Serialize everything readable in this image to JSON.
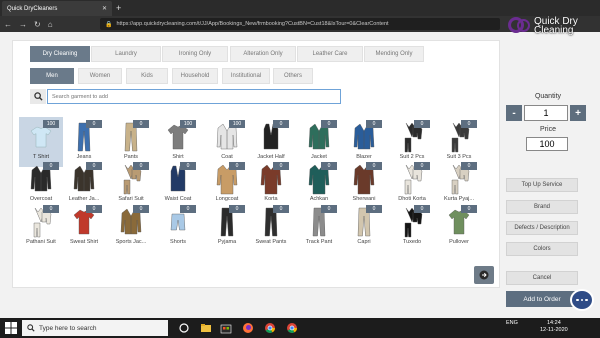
{
  "browser": {
    "tab_title": "Quick DryCleaners",
    "url": "https://app.quickdrycleaning.com/t/JJ/App/Bookings_New/frmbooking?CustBN=Cust18&IsTour=0&ClearContent"
  },
  "brand": {
    "line1": "Quick Dry",
    "line2": "Cleaning"
  },
  "service_tabs": [
    {
      "label": "Dry Cleaning",
      "active": true
    },
    {
      "label": "Laundry",
      "active": false
    },
    {
      "label": "Ironing Only",
      "active": false
    },
    {
      "label": "Alteration Only",
      "active": false
    },
    {
      "label": "Leather Care",
      "active": false
    },
    {
      "label": "Mending Only",
      "active": false
    }
  ],
  "category_tabs": [
    {
      "label": "Men",
      "active": true
    },
    {
      "label": "Women",
      "active": false
    },
    {
      "label": "Kids",
      "active": false
    },
    {
      "label": "Household",
      "active": false
    },
    {
      "label": "Institutional",
      "active": false
    },
    {
      "label": "Others",
      "active": false
    }
  ],
  "search": {
    "placeholder": "Search garment to add"
  },
  "garments": [
    {
      "label": "T Shirt",
      "count": "100",
      "selected": true,
      "icon": "tshirt",
      "color": "#cfe7f5"
    },
    {
      "label": "Jeans",
      "count": "0",
      "icon": "pants",
      "color": "#3c6fae"
    },
    {
      "label": "Pants",
      "count": "0",
      "icon": "pants",
      "color": "#c8b28a"
    },
    {
      "label": "Shirt",
      "count": "100",
      "icon": "shirt",
      "color": "#7d7d7d"
    },
    {
      "label": "Coat",
      "count": "100",
      "icon": "coat",
      "color": "#e5e5e5"
    },
    {
      "label": "Jacket Half",
      "count": "0",
      "icon": "vest",
      "color": "#222222"
    },
    {
      "label": "Jacket",
      "count": "0",
      "icon": "coat",
      "color": "#2e6e5c"
    },
    {
      "label": "Blazer",
      "count": "0",
      "icon": "coat",
      "color": "#2a5d9a"
    },
    {
      "label": "Suit 2 Pcs",
      "count": "0",
      "icon": "suit",
      "color": "#2b2b2b"
    },
    {
      "label": "Suit 3 Pcs",
      "count": "0",
      "icon": "suit",
      "color": "#3a3a3a"
    },
    {
      "label": "Overcoat",
      "count": "0",
      "icon": "coat",
      "color": "#2a2a2a"
    },
    {
      "label": "Leather Ja...",
      "count": "0",
      "icon": "coat",
      "color": "#3b342c"
    },
    {
      "label": "Safari Suit",
      "count": "0",
      "icon": "suit",
      "color": "#b99b73"
    },
    {
      "label": "Waist Coat",
      "count": "0",
      "icon": "vest",
      "color": "#223a66"
    },
    {
      "label": "Longcoat",
      "count": "0",
      "icon": "longcoat",
      "color": "#c89c66"
    },
    {
      "label": "Korta",
      "count": "0",
      "icon": "longcoat",
      "color": "#7a3b2a"
    },
    {
      "label": "Achkan",
      "count": "0",
      "icon": "longcoat",
      "color": "#1f5e5a"
    },
    {
      "label": "Sherwani",
      "count": "0",
      "icon": "longcoat",
      "color": "#6a3a2a"
    },
    {
      "label": "Dhoti Korta",
      "count": "0",
      "icon": "suit",
      "color": "#e8e4dc"
    },
    {
      "label": "Kurta Pyaj...",
      "count": "0",
      "icon": "suit",
      "color": "#d8d0c2"
    },
    {
      "label": "Pathani Suit",
      "count": "0",
      "icon": "suit",
      "color": "#eae6dd"
    },
    {
      "label": "Sweat Shirt",
      "count": "0",
      "icon": "shirt",
      "color": "#c0392b"
    },
    {
      "label": "Sports Jac...",
      "count": "0",
      "icon": "coat",
      "color": "#8a6a3a"
    },
    {
      "label": "Shorts",
      "count": "0",
      "icon": "shorts",
      "color": "#a9c9e6"
    },
    {
      "label": "Pyjama",
      "count": "0",
      "icon": "pants",
      "color": "#2b2b2b"
    },
    {
      "label": "Sweat Pants",
      "count": "0",
      "icon": "pants",
      "color": "#2f2f2f"
    },
    {
      "label": "Track Pant",
      "count": "0",
      "icon": "pants",
      "color": "#8c8c8c"
    },
    {
      "label": "Capri",
      "count": "0",
      "icon": "pants",
      "color": "#d2c6ae"
    },
    {
      "label": "Tuxedo",
      "count": "0",
      "icon": "suit",
      "color": "#151515"
    },
    {
      "label": "Pullover",
      "count": "0",
      "icon": "shirt",
      "color": "#6f8f5e"
    }
  ],
  "quantity": {
    "label": "Quantity",
    "value": "1",
    "minus": "-",
    "plus": "+"
  },
  "price": {
    "label": "Price",
    "value": "100"
  },
  "side_buttons": {
    "top_up": "Top Up Service",
    "brand": "Brand",
    "defects": "Defects / Description",
    "colors": "Colors",
    "cancel": "Cancel",
    "add_to_order": "Add to Order"
  },
  "taskbar": {
    "search_placeholder": "Type here to search",
    "lang": "ENG",
    "time": "14:24",
    "date": "12-11-2020"
  }
}
